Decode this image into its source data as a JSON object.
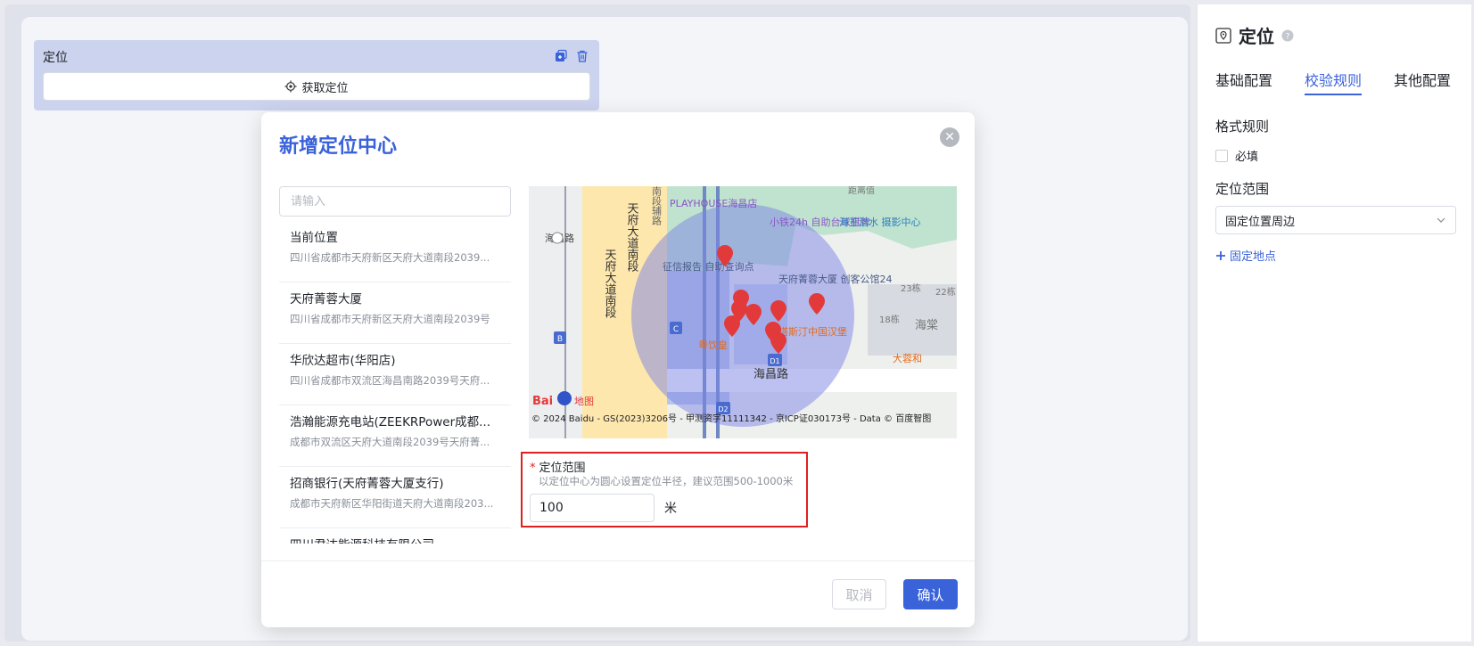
{
  "canvas": {
    "field_title": "定位",
    "get_location_label": "获取定位"
  },
  "right_panel": {
    "title": "定位",
    "tabs": [
      {
        "label": "基础配置"
      },
      {
        "label": "校验规则"
      },
      {
        "label": "其他配置"
      }
    ],
    "format_rules_title": "格式规则",
    "required_label": "必填",
    "range_title": "定位范围",
    "range_select_value": "固定位置周边",
    "add_fixed_point_label": "固定地点"
  },
  "modal": {
    "title": "新增定位中心",
    "search_placeholder": "请输入",
    "poi_items": [
      {
        "name": "当前位置",
        "address": "四川省成都市天府新区天府大道南段2039..."
      },
      {
        "name": "天府菁蓉大厦",
        "address": "四川省成都市天府新区天府大道南段2039号"
      },
      {
        "name": "华欣达超市(华阳店)",
        "address": "四川省成都市双流区海昌南路2039号天府..."
      },
      {
        "name": "浩瀚能源充电站(ZEEKRPower成都...",
        "address": "成都市双流区天府大道南段2039号天府菁..."
      },
      {
        "name": "招商银行(天府菁蓉大厦支行)",
        "address": "成都市天府新区华阳街道天府大道南段203..."
      },
      {
        "name": "四川君达能源科技有限公司",
        "address": ""
      }
    ],
    "map": {
      "labels": {
        "road_main": "天府大道南段",
        "road_main2": "天府大道南段",
        "road_side": "南段辅路",
        "haichang": "海昌路",
        "haichang_left": "海昌路",
        "playhouse": "PLAYHOUSE海昌店",
        "xiaotie": "小铁24h 自助台球棋牌",
        "haiwang": "海王潜水 摄影中心",
        "zhengxin": "征信报告 自助查询点",
        "jingrong": "天府菁蓉大厦 创客公馆24",
        "tasi": "塔斯汀中国汉堡",
        "yueyin": "粤饮皇",
        "darong": "大蓉和",
        "haitang": "海棠",
        "b23": "23栋",
        "b22": "22栋",
        "b18": "18栋",
        "juli": "距离值",
        "stop_b": "B",
        "stop_c": "C",
        "stop_d1": "D1",
        "stop_d2": "D2",
        "logo_text": "Bai",
        "logo_map": "地图",
        "copyright": "© 2024 Baidu - GS(2023)3206号 - 甲测资字11111342 - 京ICP证030173号 - Data © 百度智图"
      }
    },
    "range": {
      "label": "定位范围",
      "hint": "以定位中心为圆心设置定位半径，建议范围500-1000米",
      "value": "100",
      "unit": "米"
    },
    "cancel_label": "取消",
    "confirm_label": "确认"
  },
  "colors": {
    "accent": "#3a62d9",
    "danger": "#e02020",
    "map_circle": "#7b83e6"
  }
}
